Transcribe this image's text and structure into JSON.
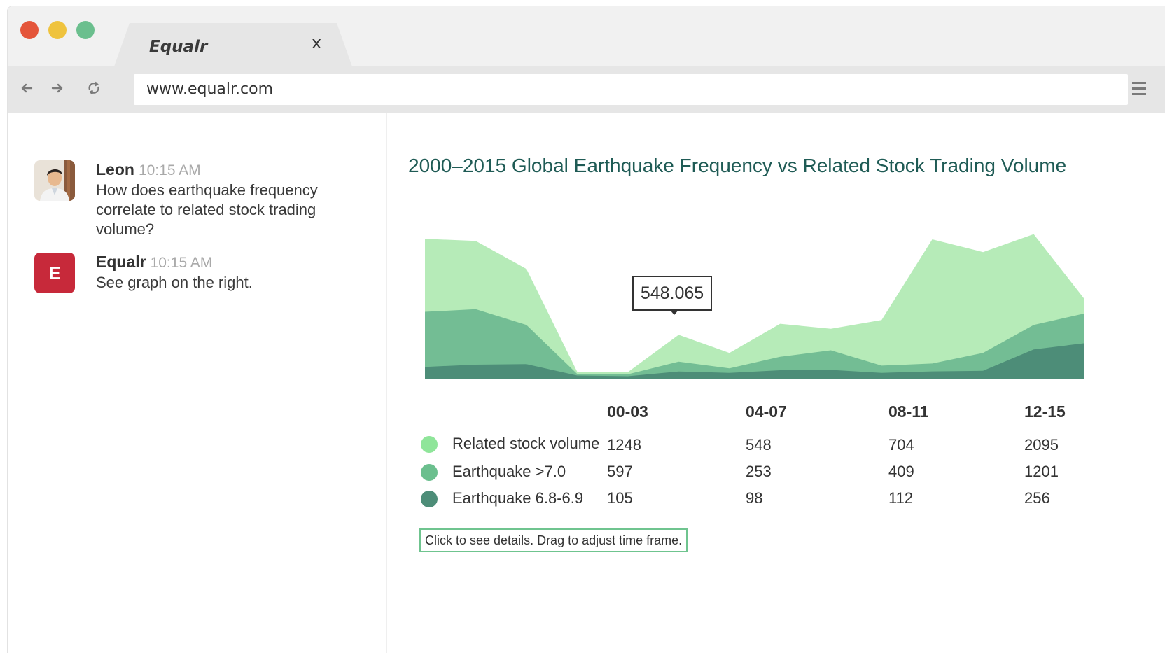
{
  "window": {
    "lights": {
      "close_color": "#e4553a",
      "minimize_color": "#efc33e",
      "maximize_color": "#6bbf8e"
    }
  },
  "tab": {
    "title": "Equalr",
    "close_label": "x"
  },
  "toolbar": {
    "back_icon": "arrow-left-icon",
    "forward_icon": "arrow-right-icon",
    "reload_icon": "reload-icon",
    "url": "www.equalr.com",
    "menu_icon": "hamburger-menu-icon"
  },
  "chat": {
    "messages": [
      {
        "name": "Leon",
        "time": "10:15 AM",
        "text": "How does earthquake frequency correlate to related stock trading volume?"
      },
      {
        "name": "Equalr",
        "time": "10:15 AM",
        "text": "See graph on the right.",
        "avatar_letter": "E",
        "avatar_color": "#c7293a"
      }
    ]
  },
  "chart_data": {
    "type": "area",
    "title": "2000–2015 Global Earthquake Frequency vs Related Stock Trading Volume",
    "xlabel": "",
    "ylabel": "",
    "grid": false,
    "tooltip_value": "548.065",
    "area_series": [
      {
        "name": "Related stock volume",
        "color": "#b6ebb8",
        "values": [
          1248,
          1230,
          980,
          62,
          59,
          391,
          230,
          490,
          445,
          524,
          1244,
          1130,
          1290,
          710
        ]
      },
      {
        "name": "Earthquake >7.0",
        "color": "#73bd94",
        "values": [
          597,
          620,
          480,
          42,
          39,
          152,
          92,
          195,
          253,
          116,
          135,
          230,
          480,
          582
        ]
      },
      {
        "name": "Earthquake 6.8-6.9",
        "color": "#4d8d78",
        "values": [
          105,
          125,
          130,
          28,
          22,
          64,
          52,
          75,
          78,
          52,
          65,
          70,
          261,
          316
        ]
      }
    ],
    "table": {
      "columns": [
        "00-03",
        "04-07",
        "08-11",
        "12-15"
      ],
      "rows": [
        {
          "label": "Related stock volume",
          "color": "#8fe59a",
          "values": [
            "1248",
            "548",
            "704",
            "2095"
          ]
        },
        {
          "label": "Earthquake >7.0",
          "color": "#6bbf8e",
          "values": [
            "597",
            "253",
            "409",
            "1201"
          ]
        },
        {
          "label": "Earthquake 6.8-6.9",
          "color": "#4d8d78",
          "values": [
            "105",
            "98",
            "112",
            "256"
          ]
        }
      ]
    }
  },
  "hint": "Click to see details. Drag to adjust time frame."
}
